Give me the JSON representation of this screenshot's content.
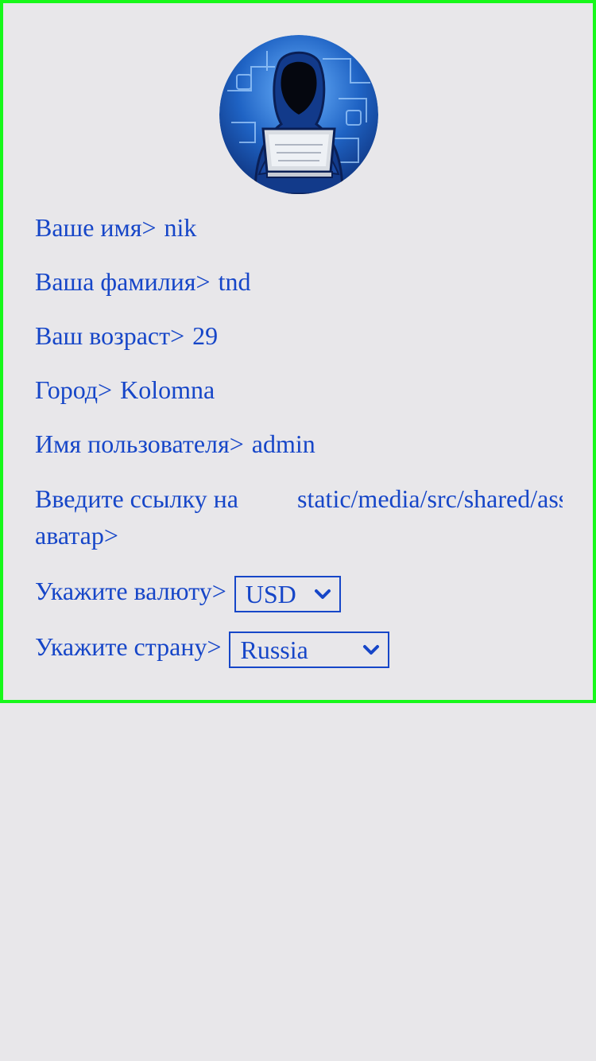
{
  "profile": {
    "first_name_label": "Ваше имя>",
    "first_name_value": "nik",
    "last_name_label": "Ваша фамилия>",
    "last_name_value": "tnd",
    "age_label": "Ваш возраст>",
    "age_value": "29",
    "city_label": "Город>",
    "city_value": "Kolomna",
    "username_label": "Имя пользователя>",
    "username_value": "admin",
    "avatar_link_label": "Введите ссылку на аватар>",
    "avatar_link_value": "static/media/src/shared/assets"
  },
  "currency": {
    "label": "Укажите валюту>",
    "selected": "USD"
  },
  "country": {
    "label": "Укажите страну>",
    "selected": "Russia"
  },
  "colors": {
    "text": "#1646c8",
    "border": "#17f81a",
    "background": "#e8e7ea"
  },
  "icons": {
    "avatar": "hooded-hacker-avatar",
    "dropdown": "chevron-down-icon"
  }
}
